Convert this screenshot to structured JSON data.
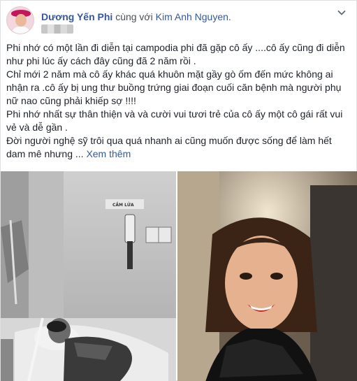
{
  "post": {
    "author": "Dương Yến Phi",
    "with_text": "cùng với",
    "tagged": "Kim Anh Nguyen.",
    "paragraphs": [
      "Phi nhớ có một lần đi diễn tại campodia phi đã gặp cô ấy ....cô ấy cũng đi diễn như phi lúc ấy cách đây cũng đã 2 năm rồi .",
      "Chỉ mới 2 năm mà cô ấy khác quá khuôn mặt gầy gò ốm đến mức không ai nhận ra .cô ấy bị ung thư buồng trứng giai đoạn cuối căn bệnh mà người phụ nữ nao cũng phải khiếp sợ !!!!",
      "Phi nhớ nhất sự thân thiện và và cười vui tươi trẻ của cô ấy một cô gái rất vui vẻ và dễ gần .",
      "Đời người nghệ sỹ trôi qua quá nhanh ai cũng muốn được sống để làm hết dam mê nhưng ..."
    ],
    "see_more": "Xem thêm",
    "sign_text": "CẮM LỬA"
  },
  "icons": {
    "menu": "chevron-down-icon",
    "avatar": "avatar-image"
  },
  "colors": {
    "link": "#365899",
    "text": "#1d2129",
    "muted": "#4b4f56",
    "border": "#dddfe2"
  }
}
